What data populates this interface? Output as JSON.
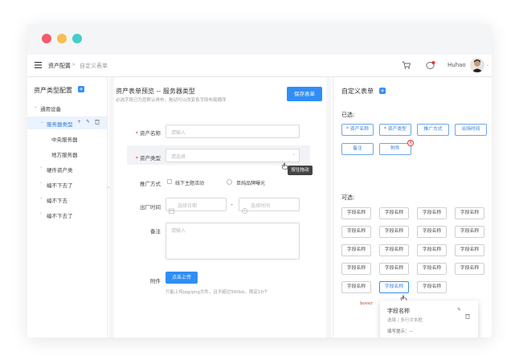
{
  "window": {
    "dots": [
      "#f35b6d",
      "#f6be52",
      "#45cdc9"
    ]
  },
  "topbar": {
    "breadcrumb_root": "资产配置",
    "breadcrumb_sep": ">",
    "breadcrumb_current": "自定义表单",
    "username": "Huhao"
  },
  "sidebar": {
    "title": "资产类型配置",
    "add_icon": "+",
    "items": [
      {
        "label": "通用设备",
        "arrow": "⌄"
      },
      {
        "label": "服务器类型",
        "arrow": "⌄"
      },
      {
        "label": "中央服务器",
        "arrow": ""
      },
      {
        "label": "地方服务器",
        "arrow": ""
      },
      {
        "label": "硬件资产类",
        "arrow": "›"
      },
      {
        "label": "编不下去了",
        "arrow": "›"
      },
      {
        "label": "编不下去",
        "arrow": "›"
      },
      {
        "label": "编不下去了",
        "arrow": "›"
      }
    ],
    "actions": [
      "+",
      "✎",
      "🗑"
    ]
  },
  "preview": {
    "title": "资产表单预览 -- 服务器类型",
    "subtitle": "必选字段已为您默认排布，拖动可以改变各字段布局顺序",
    "save_label": "保存表单",
    "fields": {
      "name_label": "资产名称",
      "name_placeholder": "请输入",
      "type_label": "资产类型",
      "type_placeholder": "请选择",
      "drag_tip": "按住拖动",
      "promo_label": "推广方式",
      "promo_opt1": "线下主题活动",
      "promo_opt2": "单纯品牌曝光",
      "date_label": "出厂时间",
      "date_placeholder": "选择日期",
      "date_sep": "-",
      "time_placeholder": "选择时间",
      "note_label": "备注",
      "note_placeholder": "请输入",
      "attach_label": "附件",
      "upload_label": "点击上传",
      "upload_hint": "只能上传jpg/png文件，且不超过500kb，限定10个",
      "required_mark": "*"
    }
  },
  "custom": {
    "title": "自定义表单",
    "add_icon": "+",
    "selected_title": "已选:",
    "selected": [
      {
        "label": "资产名称",
        "required": true
      },
      {
        "label": "资产类型",
        "required": true
      },
      {
        "label": "推广方式",
        "required": false
      },
      {
        "label": "出场时间",
        "required": false
      },
      {
        "label": "备注",
        "required": false
      },
      {
        "label": "附件",
        "required": false
      }
    ],
    "remove_icon": "×",
    "available_title": "可选:",
    "available": [
      "字段名称",
      "字段名称",
      "字段名称",
      "字段名称",
      "字段名称",
      "字段名称",
      "字段名称",
      "字段名称",
      "字段名称",
      "字段名称",
      "字段名称",
      "字段名称",
      "字段名称",
      "字段名称",
      "字段名称",
      "字段名称",
      "字段名称",
      "字段名称",
      "字段名称"
    ],
    "hover_label": "hover",
    "popup": {
      "title": "字段名称",
      "type": "选填 / 多行文本框",
      "hint": "填写提示：--"
    }
  }
}
